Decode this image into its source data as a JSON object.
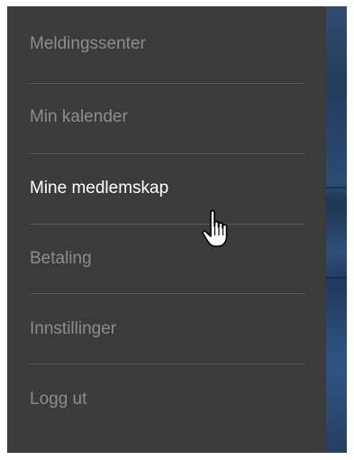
{
  "menu": {
    "items": [
      {
        "label": "Meldingssenter",
        "active": false
      },
      {
        "label": "Min kalender",
        "active": false
      },
      {
        "label": "Mine medlemskap",
        "active": true
      },
      {
        "label": "Betaling",
        "active": false
      },
      {
        "label": "Innstillinger",
        "active": false
      },
      {
        "label": "Logg ut",
        "active": false
      }
    ]
  },
  "colors": {
    "panel_background": "#3b3b3b",
    "inactive_text": "#8d8d8d",
    "active_text": "#ffffff",
    "divider": "#585858",
    "backdrop": "#2b4b74"
  },
  "cursor": {
    "icon": "hand-pointer-icon"
  }
}
